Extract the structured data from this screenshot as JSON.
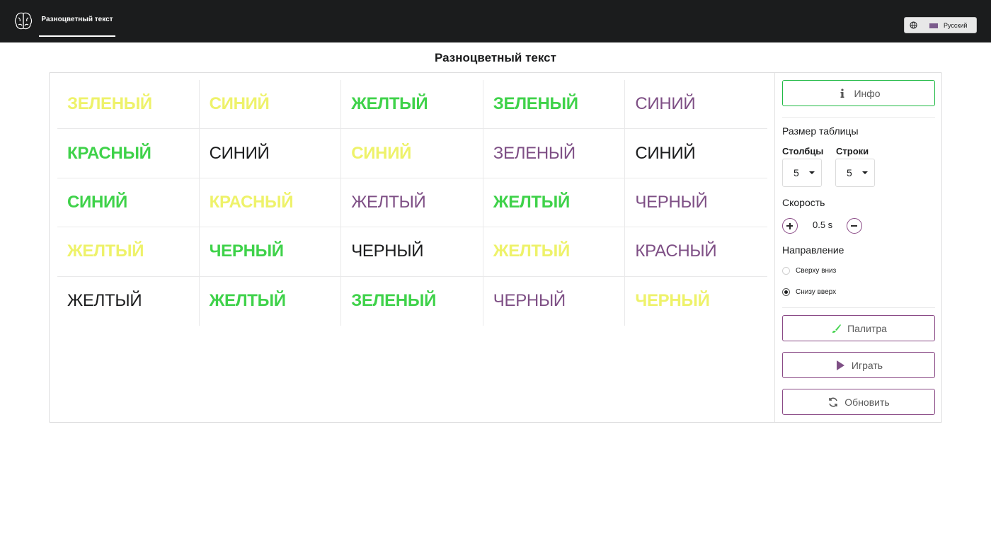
{
  "header": {
    "nav_tab": "Разноцветный текст",
    "language": "Русский"
  },
  "page": {
    "title": "Разноцветный текст"
  },
  "colors": {
    "green": "#3fd24a",
    "yellow": "#eef26a",
    "purple": "#7e4f85",
    "black": "#1b1c1d"
  },
  "grid": {
    "rows": [
      [
        {
          "word": "ЗЕЛЕНЫЙ",
          "color": "yellow"
        },
        {
          "word": "СИНИЙ",
          "color": "yellow"
        },
        {
          "word": "ЖЕЛТЫЙ",
          "color": "green"
        },
        {
          "word": "ЗЕЛЕНЫЙ",
          "color": "green"
        },
        {
          "word": "СИНИЙ",
          "color": "purple"
        }
      ],
      [
        {
          "word": "КРАСНЫЙ",
          "color": "green"
        },
        {
          "word": "СИНИЙ",
          "color": "black"
        },
        {
          "word": "СИНИЙ",
          "color": "yellow"
        },
        {
          "word": "ЗЕЛЕНЫЙ",
          "color": "purple"
        },
        {
          "word": "СИНИЙ",
          "color": "black"
        }
      ],
      [
        {
          "word": "СИНИЙ",
          "color": "green"
        },
        {
          "word": "КРАСНЫЙ",
          "color": "yellow"
        },
        {
          "word": "ЖЕЛТЫЙ",
          "color": "purple"
        },
        {
          "word": "ЖЕЛТЫЙ",
          "color": "green"
        },
        {
          "word": "ЧЕРНЫЙ",
          "color": "purple"
        }
      ],
      [
        {
          "word": "ЖЕЛТЫЙ",
          "color": "yellow"
        },
        {
          "word": "ЧЕРНЫЙ",
          "color": "green"
        },
        {
          "word": "ЧЕРНЫЙ",
          "color": "black"
        },
        {
          "word": "ЖЕЛТЫЙ",
          "color": "yellow"
        },
        {
          "word": "КРАСНЫЙ",
          "color": "purple"
        }
      ],
      [
        {
          "word": "ЖЕЛТЫЙ",
          "color": "black"
        },
        {
          "word": "ЖЕЛТЫЙ",
          "color": "green"
        },
        {
          "word": "ЗЕЛЕНЫЙ",
          "color": "green"
        },
        {
          "word": "ЧЕРНЫЙ",
          "color": "purple"
        },
        {
          "word": "ЧЕРНЫЙ",
          "color": "yellow"
        }
      ]
    ]
  },
  "sidebar": {
    "info_button": "Инфо",
    "table_size_label": "Размер таблицы",
    "columns_label": "Столбцы",
    "rows_label": "Строки",
    "columns_value": "5",
    "rows_value": "5",
    "speed_label": "Скорость",
    "speed_value": "0.5 s",
    "direction_label": "Направление",
    "direction_options": [
      "Сверху вниз",
      "Снизу вверх"
    ],
    "direction_selected": 1,
    "palette_button": "Палитра",
    "play_button": "Играть",
    "refresh_button": "Обновить"
  }
}
